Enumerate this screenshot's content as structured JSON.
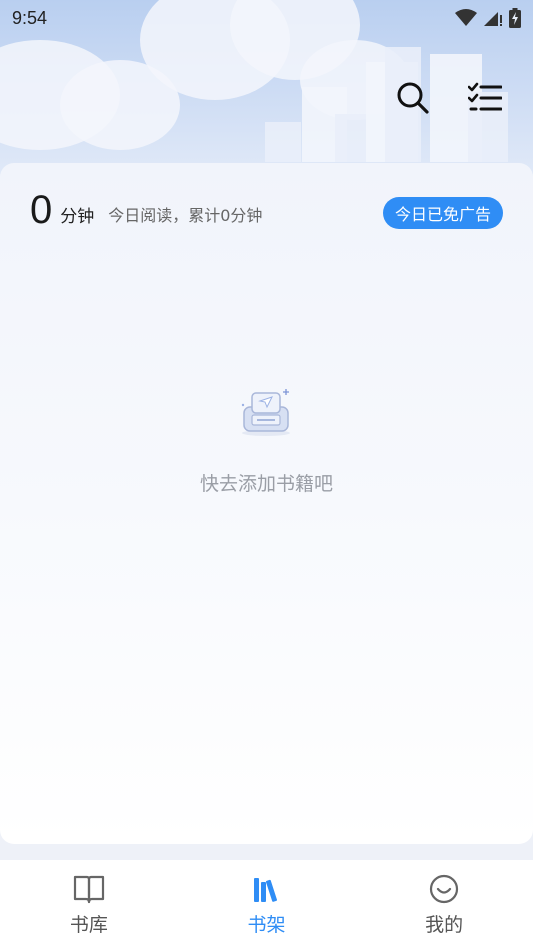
{
  "status_bar": {
    "time": "9:54",
    "icons": [
      "wifi-icon",
      "signal-icon",
      "battery-charging-icon"
    ]
  },
  "header": {
    "actions": [
      {
        "name": "search-icon"
      },
      {
        "name": "checklist-menu-icon"
      }
    ]
  },
  "reading_stats": {
    "minutes_value": "0",
    "minutes_unit": "分钟",
    "summary": "今日阅读，累计0分钟",
    "ad_free_badge": "今日已免广告"
  },
  "empty_state": {
    "icon": "empty-box-icon",
    "message": "快去添加书籍吧"
  },
  "tabbar": {
    "tabs": [
      {
        "label": "书库",
        "icon": "book-open-icon",
        "active": false
      },
      {
        "label": "书架",
        "icon": "bookshelf-icon",
        "active": true
      },
      {
        "label": "我的",
        "icon": "smile-icon",
        "active": false
      }
    ]
  },
  "colors": {
    "accent": "#2f8df5",
    "text_primary": "#1a1a1a",
    "text_secondary": "#666666",
    "empty_text": "#9a9ea6"
  }
}
